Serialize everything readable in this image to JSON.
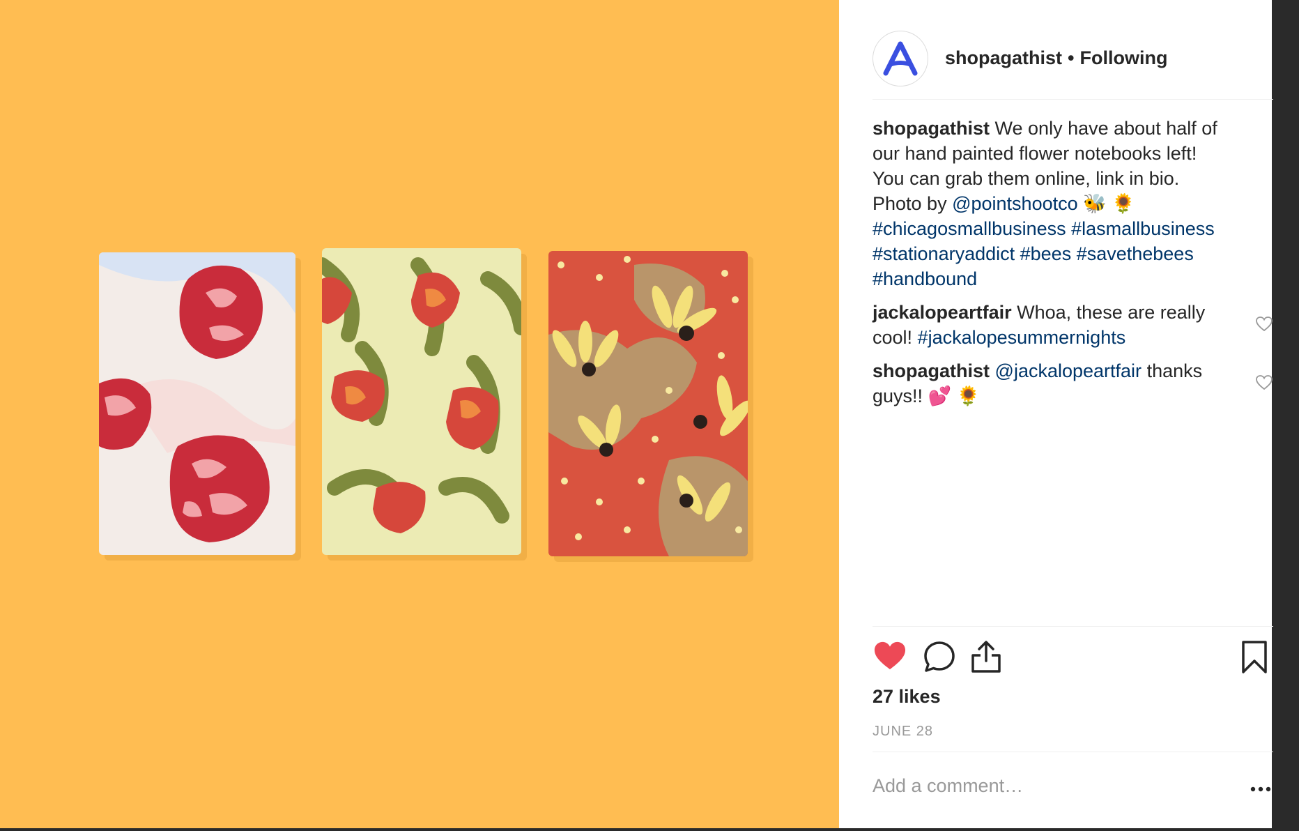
{
  "colors": {
    "photo_background": "#ffbd52",
    "link": "#003569",
    "like_active": "#ed4956",
    "brand_avatar": "#3a4fe0"
  },
  "header": {
    "username": "shopagathist",
    "separator": "•",
    "follow_status": "Following",
    "avatar_icon": "agathist-logo-icon"
  },
  "caption": {
    "username": "shopagathist",
    "text": "We only have about half of our hand painted flower notebooks left! You can grab them online, link in bio. Photo by",
    "mention": "@pointshootco",
    "emoji": "🐝 🌻",
    "hashtags": "#chicagosmallbusiness #lasmallbusiness #stationaryaddict #bees #savethebees #handbound"
  },
  "comments": [
    {
      "username": "jackalopeartfair",
      "text": "Whoa, these are really cool!",
      "hashtag": "#jackalopesummernights"
    },
    {
      "username": "shopagathist",
      "mention": "@jackalopeartfair",
      "text": "thanks guys!!",
      "emoji": "💕 🌻"
    }
  ],
  "actions": {
    "like_icon": "heart-filled-icon",
    "comment_icon": "comment-bubble-icon",
    "share_icon": "share-icon",
    "save_icon": "bookmark-icon"
  },
  "likes": "27 likes",
  "date": "JUNE 28",
  "add_comment_placeholder": "Add a comment…",
  "more_icon": "more-options-icon"
}
